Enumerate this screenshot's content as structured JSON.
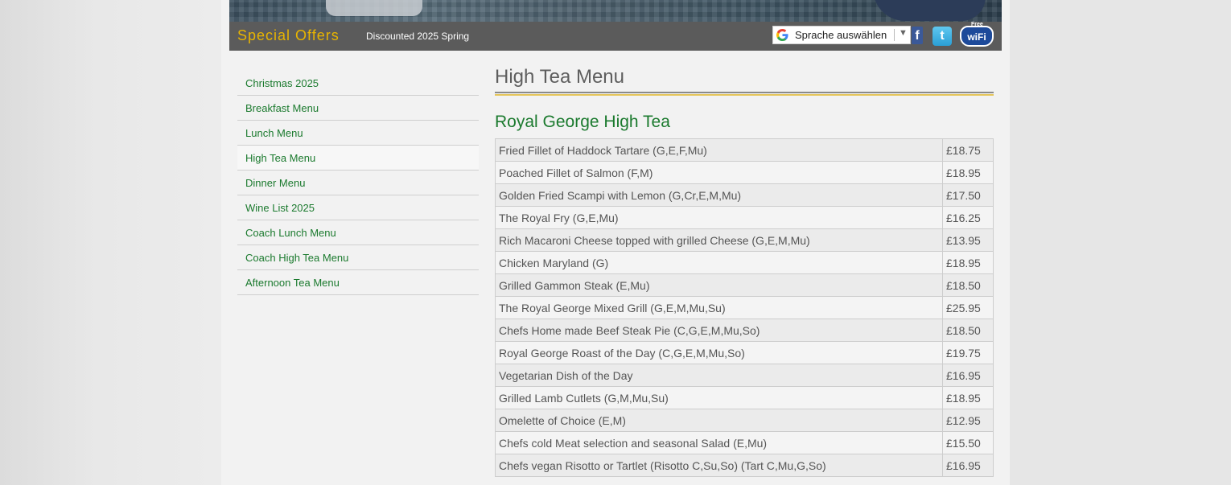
{
  "header": {
    "special_offers": "Special Offers",
    "discount_text": "Discounted 2025 Spring",
    "translate_label": "Sprache auswählen",
    "translate_arrow": "▼"
  },
  "social": {
    "facebook": "f",
    "twitter": "t",
    "wifi": "wiFi",
    "wifi_small": "Free"
  },
  "sidebar": {
    "items": [
      {
        "label": "Christmas 2025"
      },
      {
        "label": "Breakfast Menu"
      },
      {
        "label": "Lunch Menu"
      },
      {
        "label": "High Tea Menu"
      },
      {
        "label": "Dinner Menu"
      },
      {
        "label": "Wine List 2025"
      },
      {
        "label": "Coach Lunch Menu"
      },
      {
        "label": "Coach High Tea Menu"
      },
      {
        "label": "Afternoon Tea Menu"
      }
    ]
  },
  "main": {
    "page_title": "High Tea Menu",
    "section_title": "Royal George High Tea",
    "menu": [
      {
        "name": "Fried Fillet of Haddock Tartare (G,E,F,Mu)",
        "price": "£18.75"
      },
      {
        "name": "Poached Fillet of Salmon (F,M)",
        "price": "£18.95"
      },
      {
        "name": "Golden Fried Scampi with Lemon (G,Cr,E,M,Mu)",
        "price": "£17.50"
      },
      {
        "name": "The Royal Fry (G,E,Mu)",
        "price": "£16.25"
      },
      {
        "name": "Rich Macaroni Cheese topped with grilled Cheese (G,E,M,Mu)",
        "price": "£13.95"
      },
      {
        "name": "Chicken Maryland (G)",
        "price": "£18.95"
      },
      {
        "name": "Grilled Gammon Steak (E,Mu)",
        "price": "£18.50"
      },
      {
        "name": "The Royal George Mixed Grill (G,E,M,Mu,Su)",
        "price": "£25.95"
      },
      {
        "name": "Chefs Home made Beef Steak Pie (C,G,E,M,Mu,So)",
        "price": "£18.50"
      },
      {
        "name": "Royal George Roast of the Day (C,G,E,M,Mu,So)",
        "price": "£19.75"
      },
      {
        "name": "Vegetarian Dish of the Day",
        "price": "£16.95"
      },
      {
        "name": "Grilled Lamb Cutlets (G,M,Mu,Su)",
        "price": "£18.95"
      },
      {
        "name": "Omelette of Choice (E,M)",
        "price": "£12.95"
      },
      {
        "name": "Chefs cold Meat selection and seasonal Salad (E,Mu)",
        "price": "£15.50"
      },
      {
        "name": " Chefs vegan Risotto or Tartlet (Risotto C,Su,So) (Tart C,Mu,G,So)",
        "price": "£16.95"
      }
    ]
  },
  "colors": {
    "accent_green": "#1b7a2e",
    "special_gold": "#e8b400",
    "topbar_gray": "#5b5b5b"
  }
}
